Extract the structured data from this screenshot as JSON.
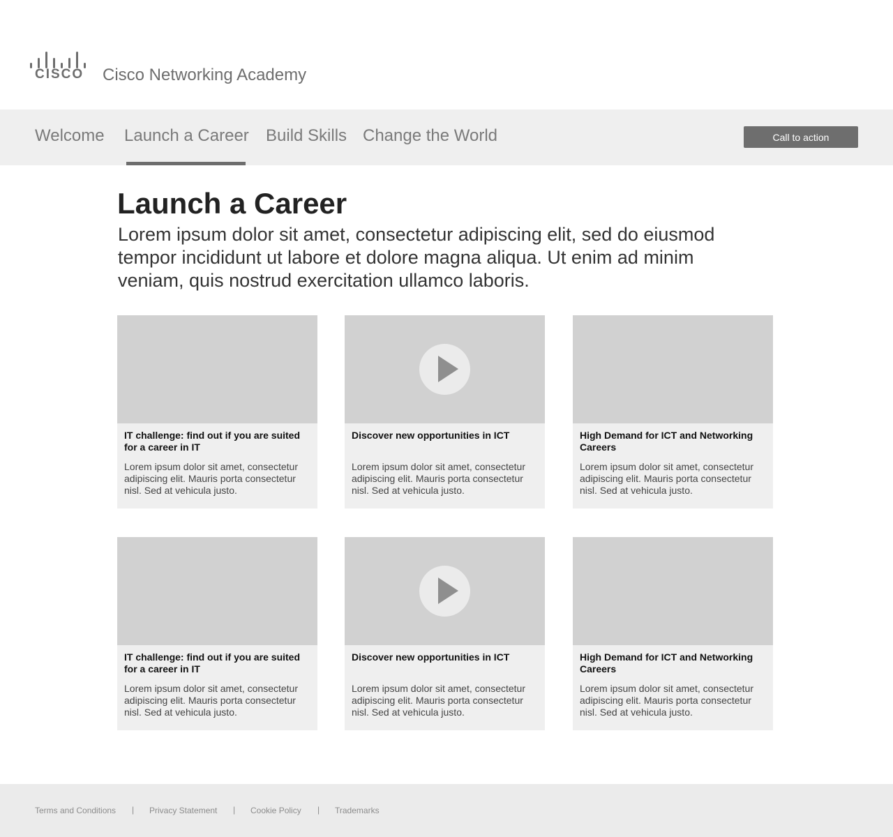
{
  "header": {
    "logo_text": "CISCO",
    "brand": "Cisco Networking Academy"
  },
  "nav": {
    "items": [
      {
        "label": "Welcome"
      },
      {
        "label": "Launch a Career",
        "active": true
      },
      {
        "label": "Build Skills"
      },
      {
        "label": "Change the World"
      }
    ],
    "cta": "Call to action"
  },
  "main": {
    "title": "Launch a Career",
    "intro": "Lorem ipsum dolor sit amet, consectetur adipiscing elit, sed do eiusmod tempor incididunt ut labore et dolore magna aliqua. Ut enim ad minim veniam, quis nostrud exercitation ullamco laboris.",
    "cards": [
      {
        "title": "IT challenge: find out if you are suited for a career in IT",
        "body": "Lorem ipsum dolor sit amet, consectetur adipiscing elit. Mauris porta consectetur nisl. Sed at vehicula justo.",
        "media": "image-placeholder"
      },
      {
        "title": "Discover new opportunities in ICT",
        "body": "Lorem ipsum dolor sit amet, consectetur adipiscing elit. Mauris porta consectetur nisl. Sed at vehicula justo.",
        "media": "play-icon"
      },
      {
        "title": "High Demand for ICT and Networking Careers",
        "body": "Lorem ipsum dolor sit amet, consectetur adipiscing elit. Mauris porta consectetur nisl. Sed at vehicula justo.",
        "media": "image-placeholder"
      },
      {
        "title": "IT challenge: find out if you are suited for a career in IT",
        "body": "Lorem ipsum dolor sit amet, consectetur adipiscing elit. Mauris porta consectetur nisl. Sed at vehicula justo.",
        "media": "image-placeholder"
      },
      {
        "title": "Discover new opportunities in ICT",
        "body": "Lorem ipsum dolor sit amet, consectetur adipiscing elit. Mauris porta consectetur nisl. Sed at vehicula justo.",
        "media": "play-icon"
      },
      {
        "title": "High Demand for ICT and Networking Careers",
        "body": "Lorem ipsum dolor sit amet, consectetur adipiscing elit. Mauris porta consectetur nisl. Sed at vehicula justo.",
        "media": "image-placeholder"
      }
    ]
  },
  "footer": {
    "links": [
      {
        "label": "Terms and Conditions"
      },
      {
        "label": "Privacy Statement"
      },
      {
        "label": "Cookie Policy"
      },
      {
        "label": "Trademarks"
      }
    ],
    "separator": "|"
  },
  "colors": {
    "nav_bg": "#efefef",
    "accent": "#6d6d6d",
    "card_bg": "#efefef",
    "media_bg": "#d1d1d1",
    "footer_bg": "#ebebeb"
  }
}
